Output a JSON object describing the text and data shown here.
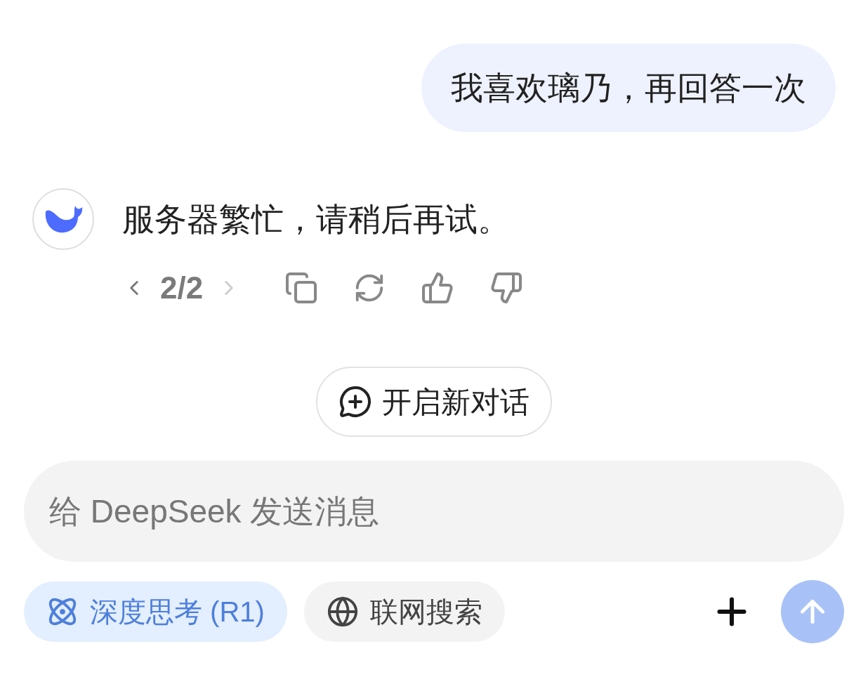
{
  "user_message": {
    "text": "我喜欢璃乃，再回答一次"
  },
  "assistant_message": {
    "text": "服务器繁忙，请稍后再试。",
    "pager": {
      "label": "2/2",
      "prev_disabled": false,
      "next_disabled": true
    }
  },
  "new_chat_button": {
    "label": "开启新对话"
  },
  "composer": {
    "placeholder": "给 DeepSeek 发送消息",
    "toggles": [
      {
        "kind": "deepthink",
        "label": "深度思考 (R1)",
        "selected": true
      },
      {
        "kind": "search",
        "label": "联网搜索",
        "selected": false
      }
    ],
    "send_disabled": true
  }
}
